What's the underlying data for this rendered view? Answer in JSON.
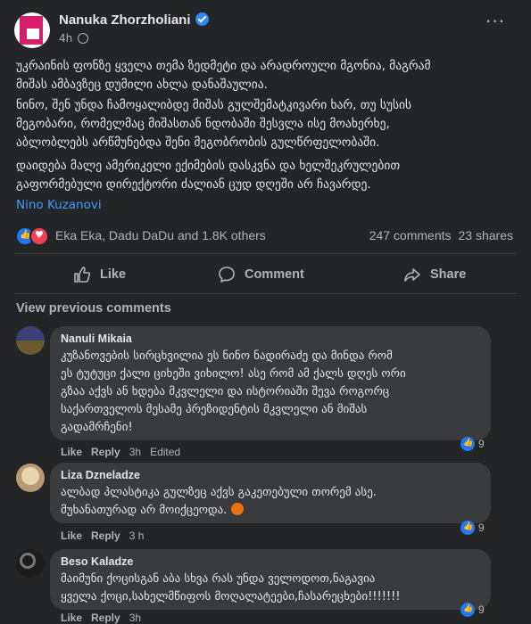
{
  "post": {
    "author": "Nanuka Zhorzholiani",
    "time": "4h",
    "more_label": "···",
    "paragraphs": [
      [
        "უკრაინის ფონზე ყველა თემა ზედმეტი და არადროული მგონია, მაგრამ",
        "მიშას ამბავზეც დუმილი ახლა დანაშაულია."
      ],
      [
        "ნინო, შენ უნდა ჩამოყალიბდე მიშას გულშემატკივარი ხარ, თუ სუსის",
        "მეგობარი, რომელმაც მიშასთან ნდობაში შესვლა ისე მოახერხე,",
        "აბლობლებს არწმუნებდა შენი მეგობრობის გულწრფელობაში."
      ],
      [
        "დაიდება მალე ამერიკელი ექიმების დასკვნა და ხელშეკრულებით",
        "გაფორმებული დირექტორი ძალიან ცუდ დღეში არ ჩავარდე."
      ]
    ],
    "tag": "Nino Kuzanovi",
    "reactions_names": "Eka Eka, Dadu DaDu and 1.8K others",
    "comments_count": "247 comments",
    "shares_count": "23 shares"
  },
  "actions": {
    "like": "Like",
    "comment": "Comment",
    "share": "Share"
  },
  "view_previous": "View previous comments",
  "comments": [
    {
      "name": "Nanuli Mikaia",
      "lines": [
        "კუზანოვების სირცხვილია ეს ნინო ნადირაძე და მინდა რომ",
        "ეს ტუტუცი ქალი ციხეში ვიხილო! ასე რომ ამ ქალს დღეს ორი",
        "გზაა აქვს ან ხდება მკვლელი და ისტორიაში შევა როგორც",
        "საქართველოს მესამე პრეზიდენტის მკვლელი ან მიშას",
        "გადამრჩენი!"
      ],
      "like": "Like",
      "reply": "Reply",
      "time": "3h",
      "edited": "Edited",
      "reaction_count": "9"
    },
    {
      "name": "Liza Dzneladze",
      "lines": [
        "ალბად პლასტიკა გულზეც აქვს გაკეთებული თორემ ასე.",
        "მუხანათურად არ მოიქცეოდა."
      ],
      "like": "Like",
      "reply": "Reply",
      "time": "3 h",
      "reaction_count": "9"
    },
    {
      "name": "Beso Kaladze",
      "lines": [
        "მაიმუნი ქოცისგან აბა სხვა რას უნდა ველოდოთ,ნაგავია",
        "ყველა ქოცი,სახელმწიფოს მოღალატეები,ჩასარეცხები!!!!!!!"
      ],
      "like": "Like",
      "reply": "Reply",
      "time": "3h",
      "reaction_count": "9"
    }
  ],
  "colors": {
    "background": "#242526",
    "bubble": "#3a3b3c",
    "link": "#4599ff",
    "like_blue": "#2078f4",
    "love_red": "#f33e58",
    "verified": "#2d88ff"
  },
  "icons": [
    "verified-badge-icon",
    "globe-icon",
    "more-icon",
    "like-reaction-icon",
    "love-reaction-icon",
    "like-icon",
    "comment-icon",
    "share-icon",
    "angry-emoji-icon"
  ]
}
